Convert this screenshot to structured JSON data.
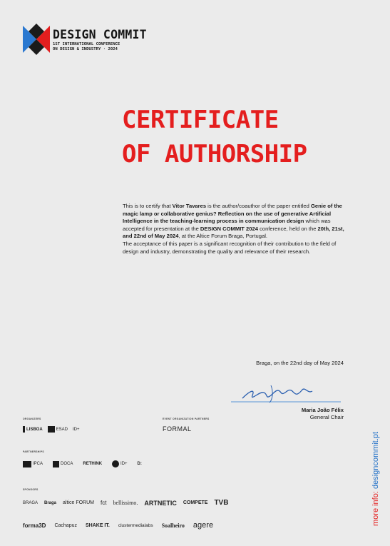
{
  "header": {
    "brand_name": "DESIGN COMMIT",
    "brand_sub_line1": "1ST INTERNATIONAL CONFERENCE",
    "brand_sub_line2": "ON DESIGN & INDUSTRY · 2024"
  },
  "certificate": {
    "title_line1": "CERTIFICATE",
    "title_line2": "OF AUTHORSHIP"
  },
  "body": {
    "p1_a": "This is to certify that ",
    "author": "Vitor Tavares",
    "p1_b": "  is the author/coauthor of the paper entitled ",
    "paper_title": "Genie of the magic lamp or collaborative genius? Reflection on the use of generative Artificial Intelligence in the teaching-learning process in communication design",
    "p1_c": " which was accepted for presentation at the ",
    "conference": "DESIGN COMMIT 2024",
    "p1_d": " conference, held on the ",
    "dates": "20th, 21st, and 22nd of May 2024",
    "p1_e": ", at the Altice Forum Braga, Portugal.",
    "p2": "The acceptance of this paper is a significant recognition of their contribution to the field of design and industry, demonstrating the quality and relevance of their research."
  },
  "closing": {
    "place_date": "Braga, on the 22nd day of May 2024",
    "signatory_name": "Maria João Félix",
    "signatory_role": "General Chair"
  },
  "side_text": {
    "prefix": "more info: ",
    "host": "designcommit.pt"
  },
  "sponsors": {
    "organizers_label": "ORGANIZERS",
    "event_partner_label": "EVENT ORGANIZATION PARTNERS",
    "partnerships_label": "PARTNERSHIPS",
    "sponsors_label": "SPONSORS",
    "organizers": [
      "LISBOA",
      "ESAD",
      "ID+"
    ],
    "event_partner": "FORMAL",
    "partners": [
      "IPCA",
      "DOCA",
      "RETHINK",
      "ID+",
      "D:"
    ],
    "sponsor_row1": [
      "BRAGA",
      "Braga",
      "altice FORUM",
      "fct",
      "bellissimo.",
      "ARTNETIC",
      "COMPETE",
      "TVB"
    ],
    "sponsor_row2": [
      "forma3D",
      "Cachapuz",
      "SHAKE IT.",
      "clustermedialabs",
      "Soalheiro",
      "agere"
    ]
  },
  "colors": {
    "accent_red": "#e41e1e",
    "link_blue": "#2070c8",
    "logo_blue": "#2a78d0"
  }
}
